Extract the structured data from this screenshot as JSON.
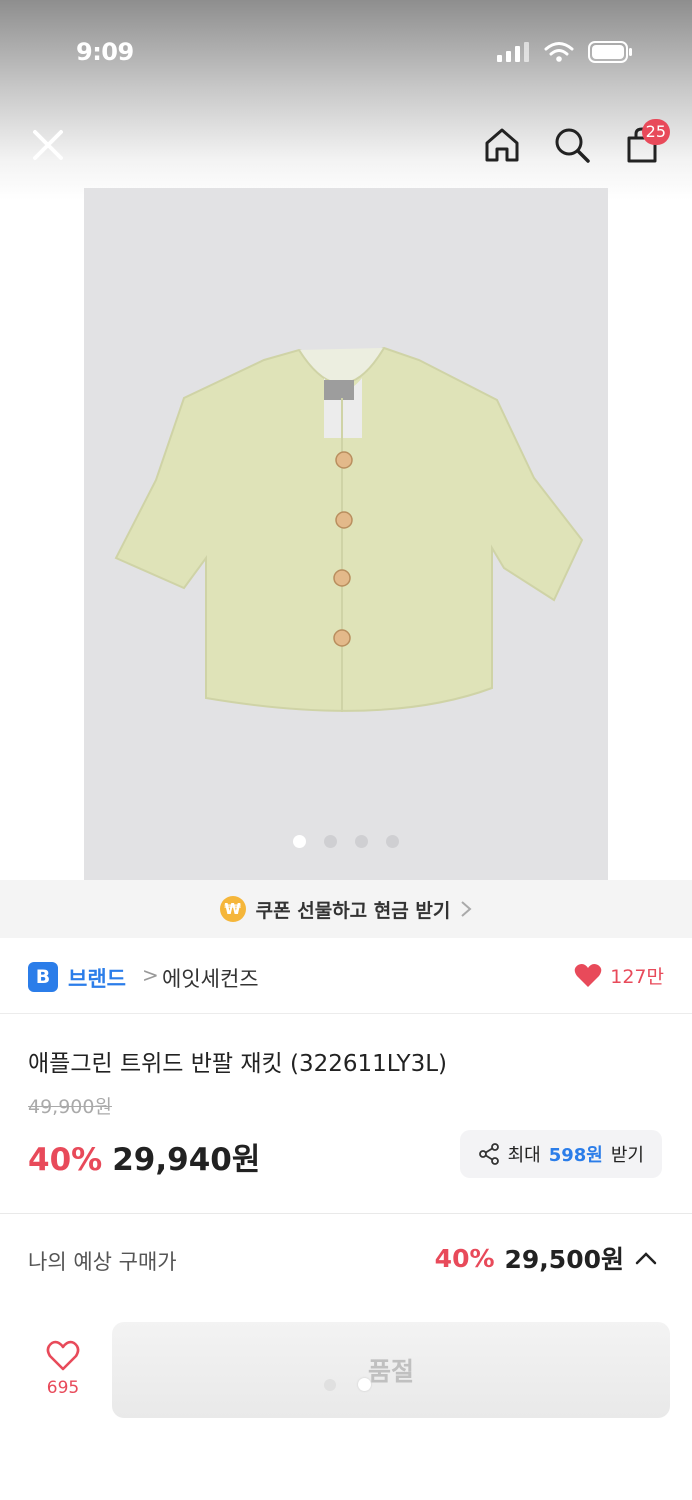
{
  "status_bar": {
    "time": "9:09"
  },
  "nav": {
    "cart_count": "25"
  },
  "gallery": {
    "pages": 4,
    "active_index": 0
  },
  "coupon": {
    "icon_text": "₩",
    "text": "쿠폰 선물하고 현금 받기"
  },
  "brand": {
    "badge": "B",
    "label": "브랜드",
    "separator": ">",
    "name": "에잇세컨즈",
    "likes": "127만"
  },
  "product": {
    "title": "애플그린 트위드 반팔 재킷 (322611LY3L)",
    "original_price": "49,900원",
    "discount": "40%",
    "price": "29,940원"
  },
  "share": {
    "prefix": "최대",
    "points": "598원",
    "suffix": "받기"
  },
  "estimate": {
    "label": "나의 예상 구매가",
    "discount": "40%",
    "price": "29,500원"
  },
  "bottom": {
    "wish_count": "695",
    "buy_button": "품절"
  },
  "colors": {
    "accent_red": "#e84a5a",
    "brand_blue": "#2b7de9",
    "coupon_gold": "#f5b63a"
  }
}
